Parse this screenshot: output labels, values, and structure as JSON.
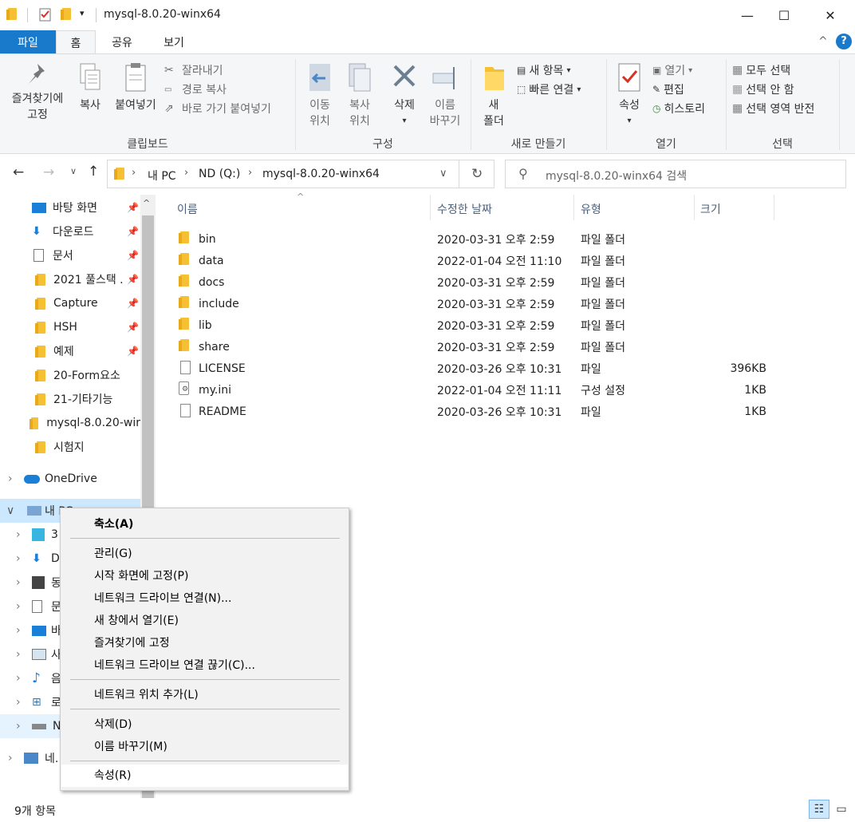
{
  "window": {
    "title": "mysql-8.0.20-winx64",
    "min": "—",
    "max": "☐",
    "close": "✕"
  },
  "tabs": {
    "file": "파일",
    "home": "홈",
    "share": "공유",
    "view": "보기"
  },
  "ribbon": {
    "pin_line1": "즐겨찾기에",
    "pin_line2": "고정",
    "copy": "복사",
    "paste": "붙여넣기",
    "cut": "잘라내기",
    "copy_path": "경로 복사",
    "paste_shortcut": "바로 가기 붙여넣기",
    "group_clipboard": "클립보드",
    "move_line1": "이동",
    "move_line2": "위치",
    "copyto_line1": "복사",
    "copyto_line2": "위치",
    "delete": "삭제",
    "rename_line1": "이름",
    "rename_line2": "바꾸기",
    "group_organize": "구성",
    "new_line1": "새",
    "new_line2": "폴더",
    "new_item": "새 항목",
    "easy_access": "빠른 연결",
    "group_new": "새로 만들기",
    "properties": "속성",
    "open": "열기",
    "edit": "편집",
    "history": "히스토리",
    "group_open": "열기",
    "select_all": "모두 선택",
    "select_none": "선택 안 함",
    "invert_selection": "선택 영역 반전",
    "group_select": "선택"
  },
  "address": {
    "pc": "내 PC",
    "drive": "ND (Q:)",
    "folder": "mysql-8.0.20-winx64"
  },
  "search": {
    "placeholder": "mysql-8.0.20-winx64 검색"
  },
  "sidebar": {
    "items": [
      {
        "label": "바탕 화면",
        "pinned": true
      },
      {
        "label": "다운로드",
        "pinned": true
      },
      {
        "label": "문서",
        "pinned": true
      },
      {
        "label": "2021 풀스택 .",
        "pinned": true
      },
      {
        "label": "Capture",
        "pinned": true
      },
      {
        "label": "HSH",
        "pinned": true
      },
      {
        "label": "예제",
        "pinned": true
      },
      {
        "label": "20-Form요소",
        "pinned": false
      },
      {
        "label": "21-기타기능",
        "pinned": false
      },
      {
        "label": "mysql-8.0.20-wir",
        "pinned": false
      },
      {
        "label": "시험지",
        "pinned": false
      }
    ],
    "onedrive": "OneDrive",
    "thispc": "내 PC",
    "pc_children": [
      "3",
      "D",
      "동",
      "문",
      "바",
      "사",
      "음",
      "로",
      "N"
    ],
    "network": "네."
  },
  "columns": {
    "name": "이름",
    "modified": "수정한 날짜",
    "type": "유형",
    "size": "크기"
  },
  "files": [
    {
      "name": "bin",
      "date": "2020-03-31 오후 2:59",
      "type": "파일 폴더",
      "size": "",
      "kind": "folder"
    },
    {
      "name": "data",
      "date": "2022-01-04 오전 11:10",
      "type": "파일 폴더",
      "size": "",
      "kind": "folder"
    },
    {
      "name": "docs",
      "date": "2020-03-31 오후 2:59",
      "type": "파일 폴더",
      "size": "",
      "kind": "folder"
    },
    {
      "name": "include",
      "date": "2020-03-31 오후 2:59",
      "type": "파일 폴더",
      "size": "",
      "kind": "folder"
    },
    {
      "name": "lib",
      "date": "2020-03-31 오후 2:59",
      "type": "파일 폴더",
      "size": "",
      "kind": "folder"
    },
    {
      "name": "share",
      "date": "2020-03-31 오후 2:59",
      "type": "파일 폴더",
      "size": "",
      "kind": "folder"
    },
    {
      "name": "LICENSE",
      "date": "2020-03-26 오후 10:31",
      "type": "파일",
      "size": "396KB",
      "kind": "file"
    },
    {
      "name": "my.ini",
      "date": "2022-01-04 오전 11:11",
      "type": "구성 설정",
      "size": "1KB",
      "kind": "ini"
    },
    {
      "name": "README",
      "date": "2020-03-26 오후 10:31",
      "type": "파일",
      "size": "1KB",
      "kind": "file"
    }
  ],
  "context_menu": {
    "collapse": "축소(A)",
    "manage": "관리(G)",
    "pin_start": "시작 화면에 고정(P)",
    "map_drive": "네트워크 드라이브 연결(N)...",
    "open_new": "새 창에서 열기(E)",
    "pin_quick": "즐겨찾기에 고정",
    "disconnect": "네트워크 드라이브 연결 끊기(C)...",
    "add_network": "네트워크 위치 추가(L)",
    "delete": "삭제(D)",
    "rename": "이름 바꾸기(M)",
    "properties": "속성(R)"
  },
  "status": {
    "count": "9개 항목"
  },
  "colors": {
    "accent": "#1979ca",
    "folder": "#f5c033"
  }
}
